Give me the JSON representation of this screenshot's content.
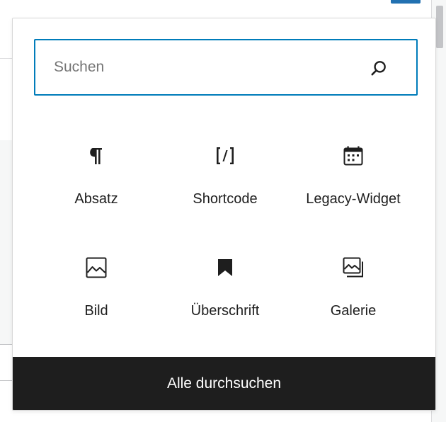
{
  "search": {
    "placeholder": "Suchen",
    "value": ""
  },
  "blocks": [
    {
      "label": "Absatz",
      "icon": "paragraph-icon"
    },
    {
      "label": "Shortcode",
      "icon": "shortcode-icon"
    },
    {
      "label": "Legacy-Widget",
      "icon": "calendar-icon"
    },
    {
      "label": "Bild",
      "icon": "image-icon"
    },
    {
      "label": "Überschrift",
      "icon": "bookmark-icon"
    },
    {
      "label": "Galerie",
      "icon": "gallery-icon"
    }
  ],
  "browse_all": {
    "label": "Alle durchsuchen"
  },
  "colors": {
    "accent": "#007cba",
    "text": "#1e1e1e",
    "footer_bg": "#1e1e1e",
    "footer_text": "#ffffff",
    "placeholder": "#757575"
  }
}
